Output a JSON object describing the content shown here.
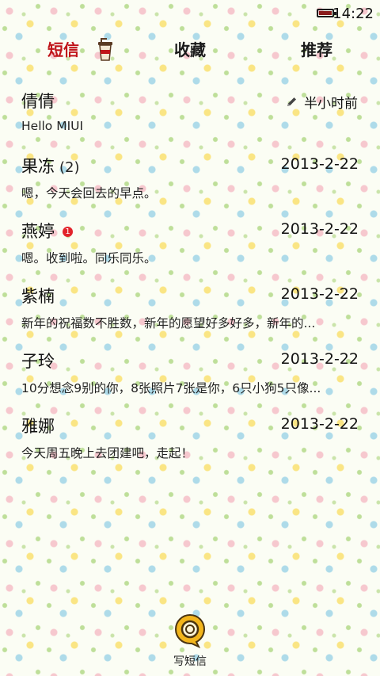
{
  "status_bar": {
    "time": "14:22",
    "battery_icon": "battery-icon"
  },
  "tabs": [
    {
      "label": "短信",
      "active": true,
      "icon": "coffee-cup-icon"
    },
    {
      "label": "收藏",
      "active": false
    },
    {
      "label": "推荐",
      "active": false
    }
  ],
  "colors": {
    "active_tab": "#c0141a",
    "unread_badge": "#e2242b",
    "compose_accent": "#f2b51c"
  },
  "conversations": [
    {
      "name": "倩倩",
      "time": "半小时前",
      "time_icon": "pencil-icon",
      "preview": "Hello MIUI"
    },
    {
      "name": "果冻",
      "count": "(2)",
      "time": "2013-2-22",
      "preview": "嗯，今天会回去的早点。"
    },
    {
      "name": "燕婷",
      "badge": "1",
      "time": "2013-2-22",
      "preview": "嗯。收到啦。同乐同乐。"
    },
    {
      "name": "紫楠",
      "time": "2013-2-22",
      "preview": "新年的祝福数不胜数，新年的愿望好多好多，新年的..."
    },
    {
      "name": "子玲",
      "time": "2013-2-22",
      "preview": "10分想念9别的你，8张照片7张是你，6只小狗5只像..."
    },
    {
      "name": "雅娜",
      "time": "2013-2-22",
      "preview": "今天周五晚上去团建吧，走起！"
    }
  ],
  "compose": {
    "label": "写短信",
    "icon": "compose-bubble-icon"
  }
}
